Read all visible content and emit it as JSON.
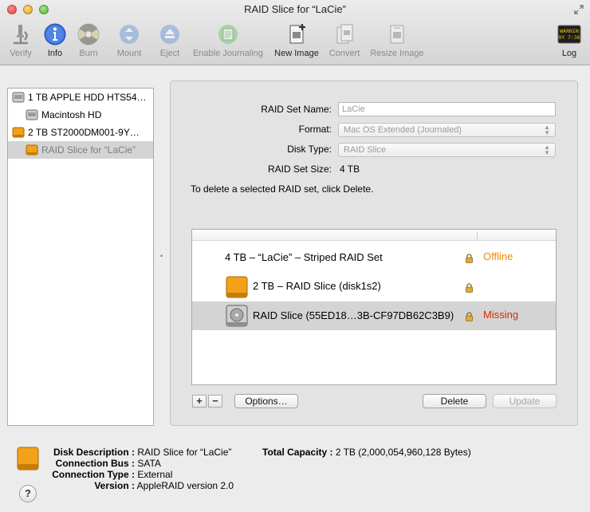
{
  "window": {
    "title": "RAID Slice for “LaCie”"
  },
  "toolbar": {
    "verify": "Verify",
    "info": "Info",
    "burn": "Burn",
    "mount": "Mount",
    "eject": "Eject",
    "enable_journaling": "Enable Journaling",
    "new_image": "New Image",
    "convert": "Convert",
    "resize_image": "Resize Image",
    "log": "Log",
    "log_icon_text": [
      "WARNIN",
      "9Y 7:36"
    ]
  },
  "sidebar": {
    "items": [
      {
        "label": "1 TB APPLE HDD HTS54…",
        "icon": "internal-disk-icon"
      },
      {
        "label": "Macintosh HD",
        "icon": "volume-icon"
      },
      {
        "label": "2 TB ST2000DM001-9Y…",
        "icon": "external-disk-icon"
      },
      {
        "label": "RAID Slice for “LaCie”",
        "icon": "raid-slice-icon"
      }
    ]
  },
  "raid_form": {
    "name_label": "RAID Set Name:",
    "name_value": "LaCie",
    "format_label": "Format:",
    "format_value": "Mac OS Extended (Journaled)",
    "disk_type_label": "Disk Type:",
    "disk_type_value": "RAID Slice",
    "size_label": "RAID Set Size:",
    "size_value": "4 TB",
    "note": "To delete a selected RAID set, click Delete."
  },
  "members": {
    "rows": [
      {
        "name": "4 TB – “LaCie” – Striped RAID Set",
        "status": "Offline"
      },
      {
        "name": "2 TB – RAID Slice (disk1s2)",
        "status": ""
      },
      {
        "name": "RAID Slice (55ED18…3B-CF97DB62C3B9)",
        "status": "Missing"
      }
    ]
  },
  "buttons": {
    "add": "+",
    "remove": "−",
    "options": "Options…",
    "delete": "Delete",
    "update": "Update",
    "help": "?"
  },
  "info": {
    "disk_description_label": "Disk Description :",
    "disk_description_value": "RAID Slice for “LaCie”",
    "connection_bus_label": "Connection Bus :",
    "connection_bus_value": "SATA",
    "connection_type_label": "Connection Type :",
    "connection_type_value": "External",
    "version_label": "Version :",
    "version_value": "AppleRAID version 2.0",
    "total_capacity_label": "Total Capacity :",
    "total_capacity_value": "2 TB (2,000,054,960,128 Bytes)"
  },
  "colors": {
    "offline": "#f08a00",
    "missing": "#e32400",
    "selection": "#d4d4d4",
    "info_accent": "#3b6fd6"
  }
}
